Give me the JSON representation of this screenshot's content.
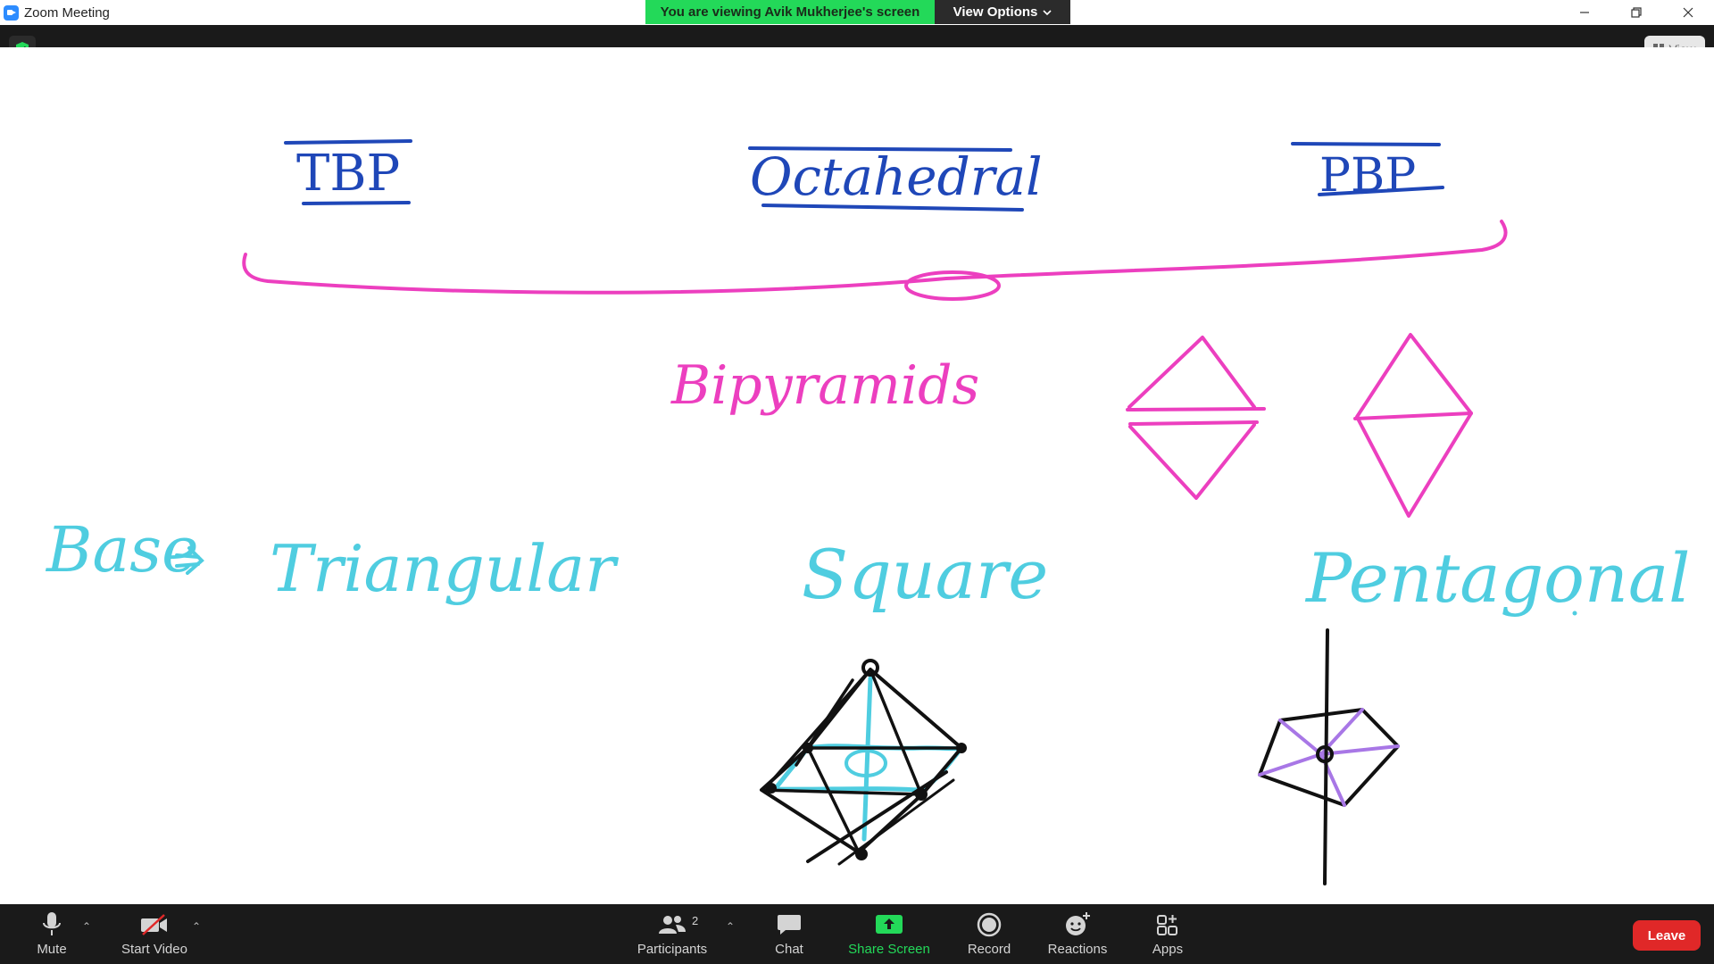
{
  "window": {
    "title": "Zoom Meeting",
    "controls": [
      "minimize",
      "restore",
      "close"
    ]
  },
  "banner": {
    "viewing_text": "You are viewing Avik Mukherjee's screen",
    "view_options_label": "View Options"
  },
  "view_pill": {
    "label": "View"
  },
  "whiteboard": {
    "headings": [
      "TBP",
      "Octahedral",
      "PBP"
    ],
    "group_label": "Bipyramids",
    "base_label": "Base",
    "shapes": [
      "Triangular",
      "Square",
      "Pentagonal"
    ],
    "colors": {
      "heading": "#1f47b8",
      "brace": "#ec3fbf",
      "base": "#4fcde0",
      "drawing": "#111111",
      "purple": "#a877e6"
    }
  },
  "toolbar": {
    "mute_label": "Mute",
    "video_label": "Start Video",
    "participants_label": "Participants",
    "participants_count": "2",
    "chat_label": "Chat",
    "share_label": "Share Screen",
    "record_label": "Record",
    "reactions_label": "Reactions",
    "apps_label": "Apps",
    "leave_label": "Leave",
    "colors": {
      "share": "#23d959",
      "leave": "#e02828"
    }
  }
}
